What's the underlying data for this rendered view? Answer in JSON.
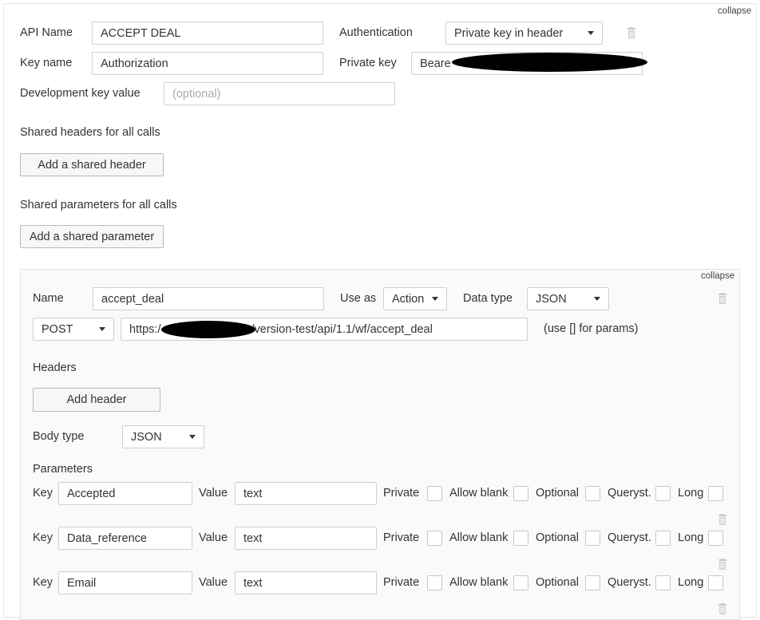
{
  "api": {
    "collapse_label": "collapse",
    "api_name_label": "API Name",
    "api_name_value": "ACCEPT DEAL",
    "auth_label": "Authentication",
    "auth_value": "Private key in header",
    "key_name_label": "Key name",
    "key_name_value": "Authorization",
    "private_key_label": "Private key",
    "private_key_value": "Beare",
    "dev_key_label": "Development key value",
    "dev_key_placeholder": "(optional)",
    "shared_headers_label": "Shared headers for all calls",
    "add_shared_header": "Add a shared header",
    "shared_params_label": "Shared parameters for all calls",
    "add_shared_param": "Add a shared parameter"
  },
  "call": {
    "collapse_label": "collapse",
    "name_label": "Name",
    "name_value": "accept_deal",
    "use_as_label": "Use as",
    "use_as_value": "Action",
    "data_type_label": "Data type",
    "data_type_value": "JSON",
    "method_value": "POST",
    "url_prefix": "https:/",
    "url_suffix": "/version-test/api/1.1/wf/accept_deal",
    "url_hint": "(use [] for params)",
    "headers_label": "Headers",
    "add_header": "Add header",
    "body_type_label": "Body type",
    "body_type_value": "JSON",
    "parameters_label": "Parameters",
    "param_key_label": "Key",
    "param_value_label": "Value",
    "flag_private": "Private",
    "flag_allow_blank": "Allow blank",
    "flag_optional": "Optional",
    "flag_queryst": "Queryst.",
    "flag_long": "Long",
    "params": [
      {
        "key": "Accepted",
        "value": "text"
      },
      {
        "key": "Data_reference",
        "value": "text"
      },
      {
        "key": "Email",
        "value": "text"
      }
    ]
  }
}
